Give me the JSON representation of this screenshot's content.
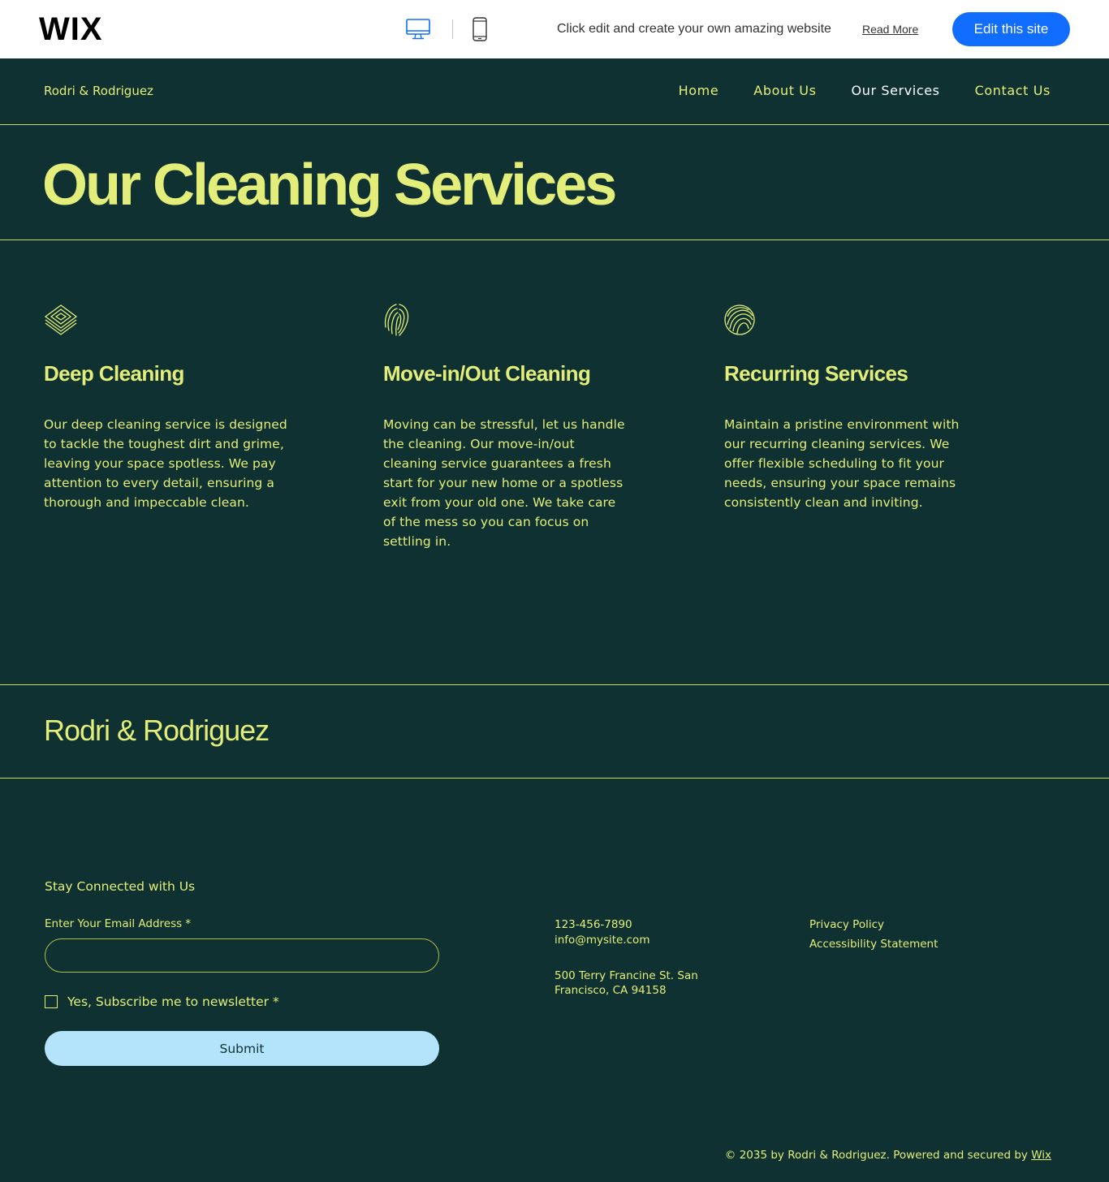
{
  "wix_bar": {
    "logo": "WIX",
    "message": "Click edit and create your own amazing website",
    "read_more": "Read More",
    "edit_button": "Edit this site"
  },
  "header": {
    "site_name": "Rodri & Rodriguez",
    "nav": [
      "Home",
      "About Us",
      "Our Services",
      "Contact Us"
    ],
    "active_nav": "Our Services"
  },
  "main": {
    "title": "Our Cleaning Services",
    "services": [
      {
        "icon": "layered-diamond-icon",
        "title": "Deep Cleaning",
        "description": "Our deep cleaning service is designed to tackle the toughest dirt and grime, leaving your space spotless. We pay attention to every detail, ensuring a thorough and impeccable clean."
      },
      {
        "icon": "fingerprint-arcs-icon",
        "title": "Move-in/Out Cleaning",
        "description": "Moving can be stressful, let us handle the cleaning. Our move-in/out cleaning service guarantees a fresh start for your new home or a spotless exit from your old one. We take care of the mess so you can focus on settling in."
      },
      {
        "icon": "swirl-circle-icon",
        "title": "Recurring Services",
        "description": "Maintain a pristine environment with our recurring cleaning services. We offer flexible scheduling to fit your needs, ensuring your space remains consistently clean and inviting."
      }
    ]
  },
  "footer": {
    "brand": "Rodri & Rodriguez",
    "form": {
      "heading": "Stay Connected with Us",
      "email_label": "Enter Your Email Address *",
      "email_value": "",
      "subscribe_label": "Yes, Subscribe me to newsletter *",
      "subscribe_checked": false,
      "submit": "Submit"
    },
    "contact": {
      "phone": "123-456-7890",
      "email": "info@mysite.com",
      "address_line1": "500 Terry Francine St. San",
      "address_line2": "Francisco, CA 94158"
    },
    "legal": [
      "Privacy Policy",
      "Accessibility Statement"
    ],
    "copyright": "© 2035 by Rodri & Rodriguez. Powered and secured by",
    "copyright_link": "Wix"
  },
  "colors": {
    "background": "#0f3131",
    "accent": "#e3ee7a",
    "wix_blue": "#116dff",
    "submit_bg": "#b4e4fc"
  }
}
